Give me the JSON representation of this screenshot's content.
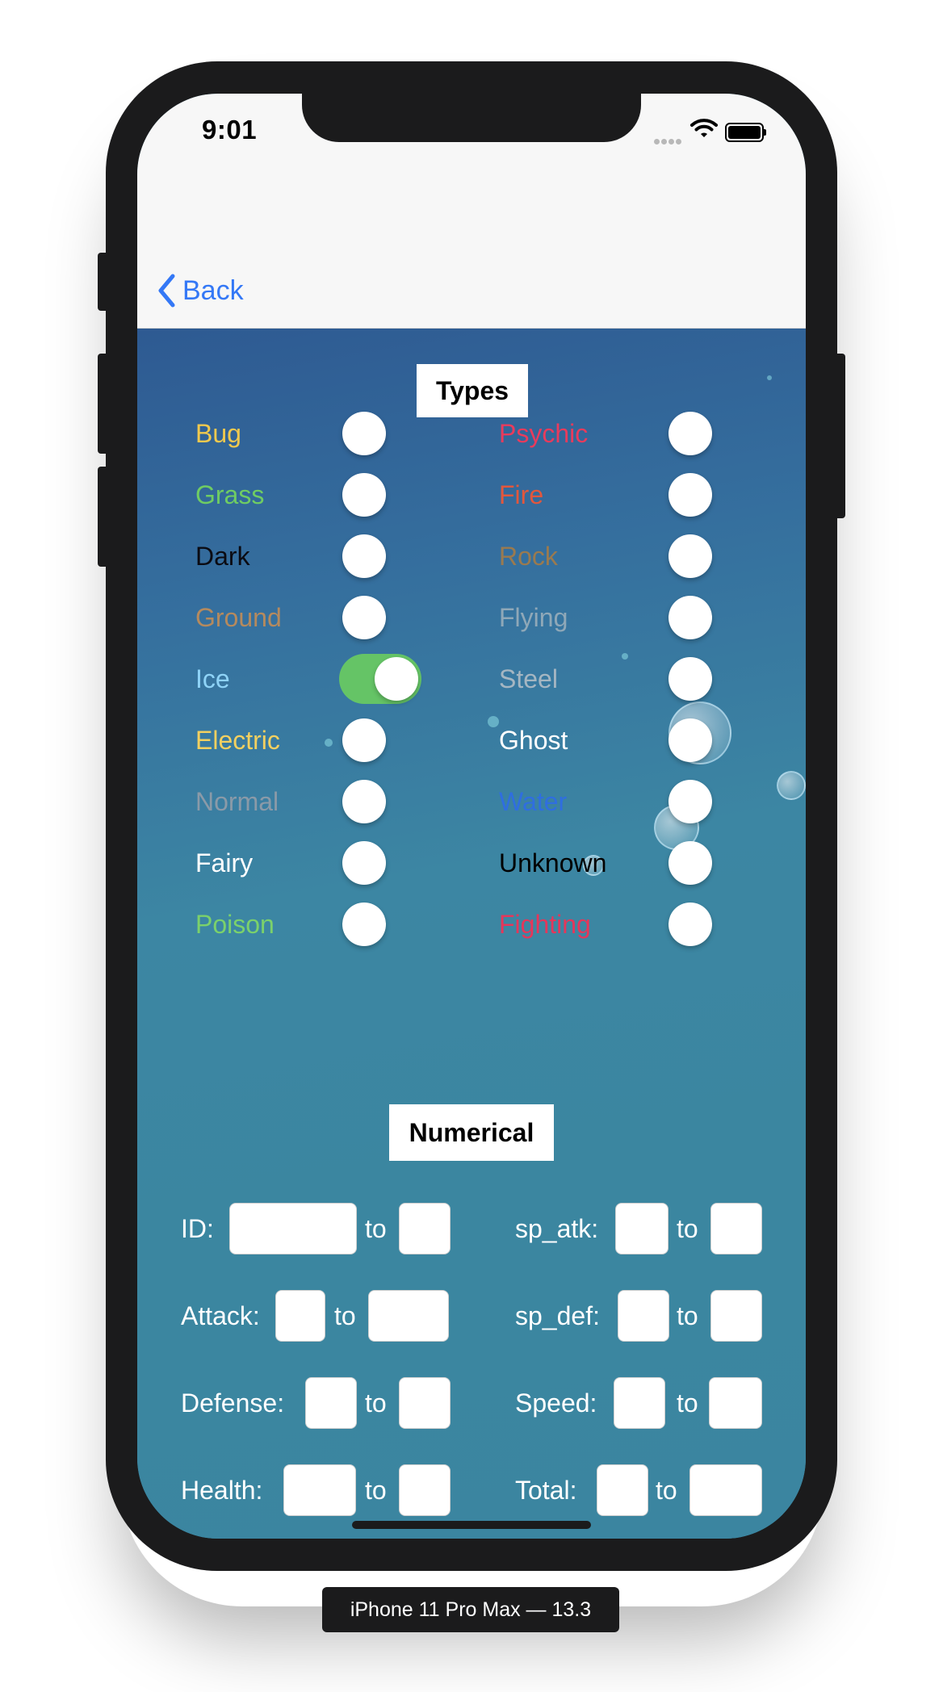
{
  "status_bar": {
    "time": "9:01"
  },
  "nav": {
    "back_label": "Back"
  },
  "types": {
    "title": "Types",
    "left": [
      {
        "label": "Bug",
        "color": "#f0c94e",
        "on": false
      },
      {
        "label": "Grass",
        "color": "#6fcc63",
        "on": false
      },
      {
        "label": "Dark",
        "color": "#0b0b12",
        "on": false
      },
      {
        "label": "Ground",
        "color": "#b58a5e",
        "on": false
      },
      {
        "label": "Ice",
        "color": "#8fd3f7",
        "on": true
      },
      {
        "label": "Electric",
        "color": "#f3d060",
        "on": false
      },
      {
        "label": "Normal",
        "color": "#8a9aa8",
        "on": false
      },
      {
        "label": "Fairy",
        "color": "#ffffff",
        "on": false
      },
      {
        "label": "Poison",
        "color": "#7bd16b",
        "on": false
      }
    ],
    "right": [
      {
        "label": "Psychic",
        "color": "#e93b5c",
        "on": false
      },
      {
        "label": "Fire",
        "color": "#e2573d",
        "on": false
      },
      {
        "label": "Rock",
        "color": "#9a7a4f",
        "on": false
      },
      {
        "label": "Flying",
        "color": "#8fa8b8",
        "on": false
      },
      {
        "label": "Steel",
        "color": "#a5b6c2",
        "on": false
      },
      {
        "label": "Ghost",
        "color": "#ffffff",
        "on": false
      },
      {
        "label": "Water",
        "color": "#2f6ee0",
        "on": false
      },
      {
        "label": "Unknown",
        "color": "#000000",
        "on": false
      },
      {
        "label": "Fighting",
        "color": "#e5365a",
        "on": false
      }
    ]
  },
  "numerical": {
    "title": "Numerical",
    "to_label": "to",
    "left": [
      {
        "label": "ID:",
        "from": "",
        "to": ""
      },
      {
        "label": "Attack:",
        "from": "",
        "to": ""
      },
      {
        "label": "Defense:",
        "from": "",
        "to": ""
      },
      {
        "label": "Health:",
        "from": "",
        "to": ""
      }
    ],
    "right": [
      {
        "label": "sp_atk:",
        "from": "",
        "to": ""
      },
      {
        "label": "sp_def:",
        "from": "",
        "to": ""
      },
      {
        "label": "Speed:",
        "from": "",
        "to": ""
      },
      {
        "label": "Total:",
        "from": "",
        "to": ""
      }
    ]
  },
  "device_label": "iPhone 11 Pro Max — 13.3"
}
